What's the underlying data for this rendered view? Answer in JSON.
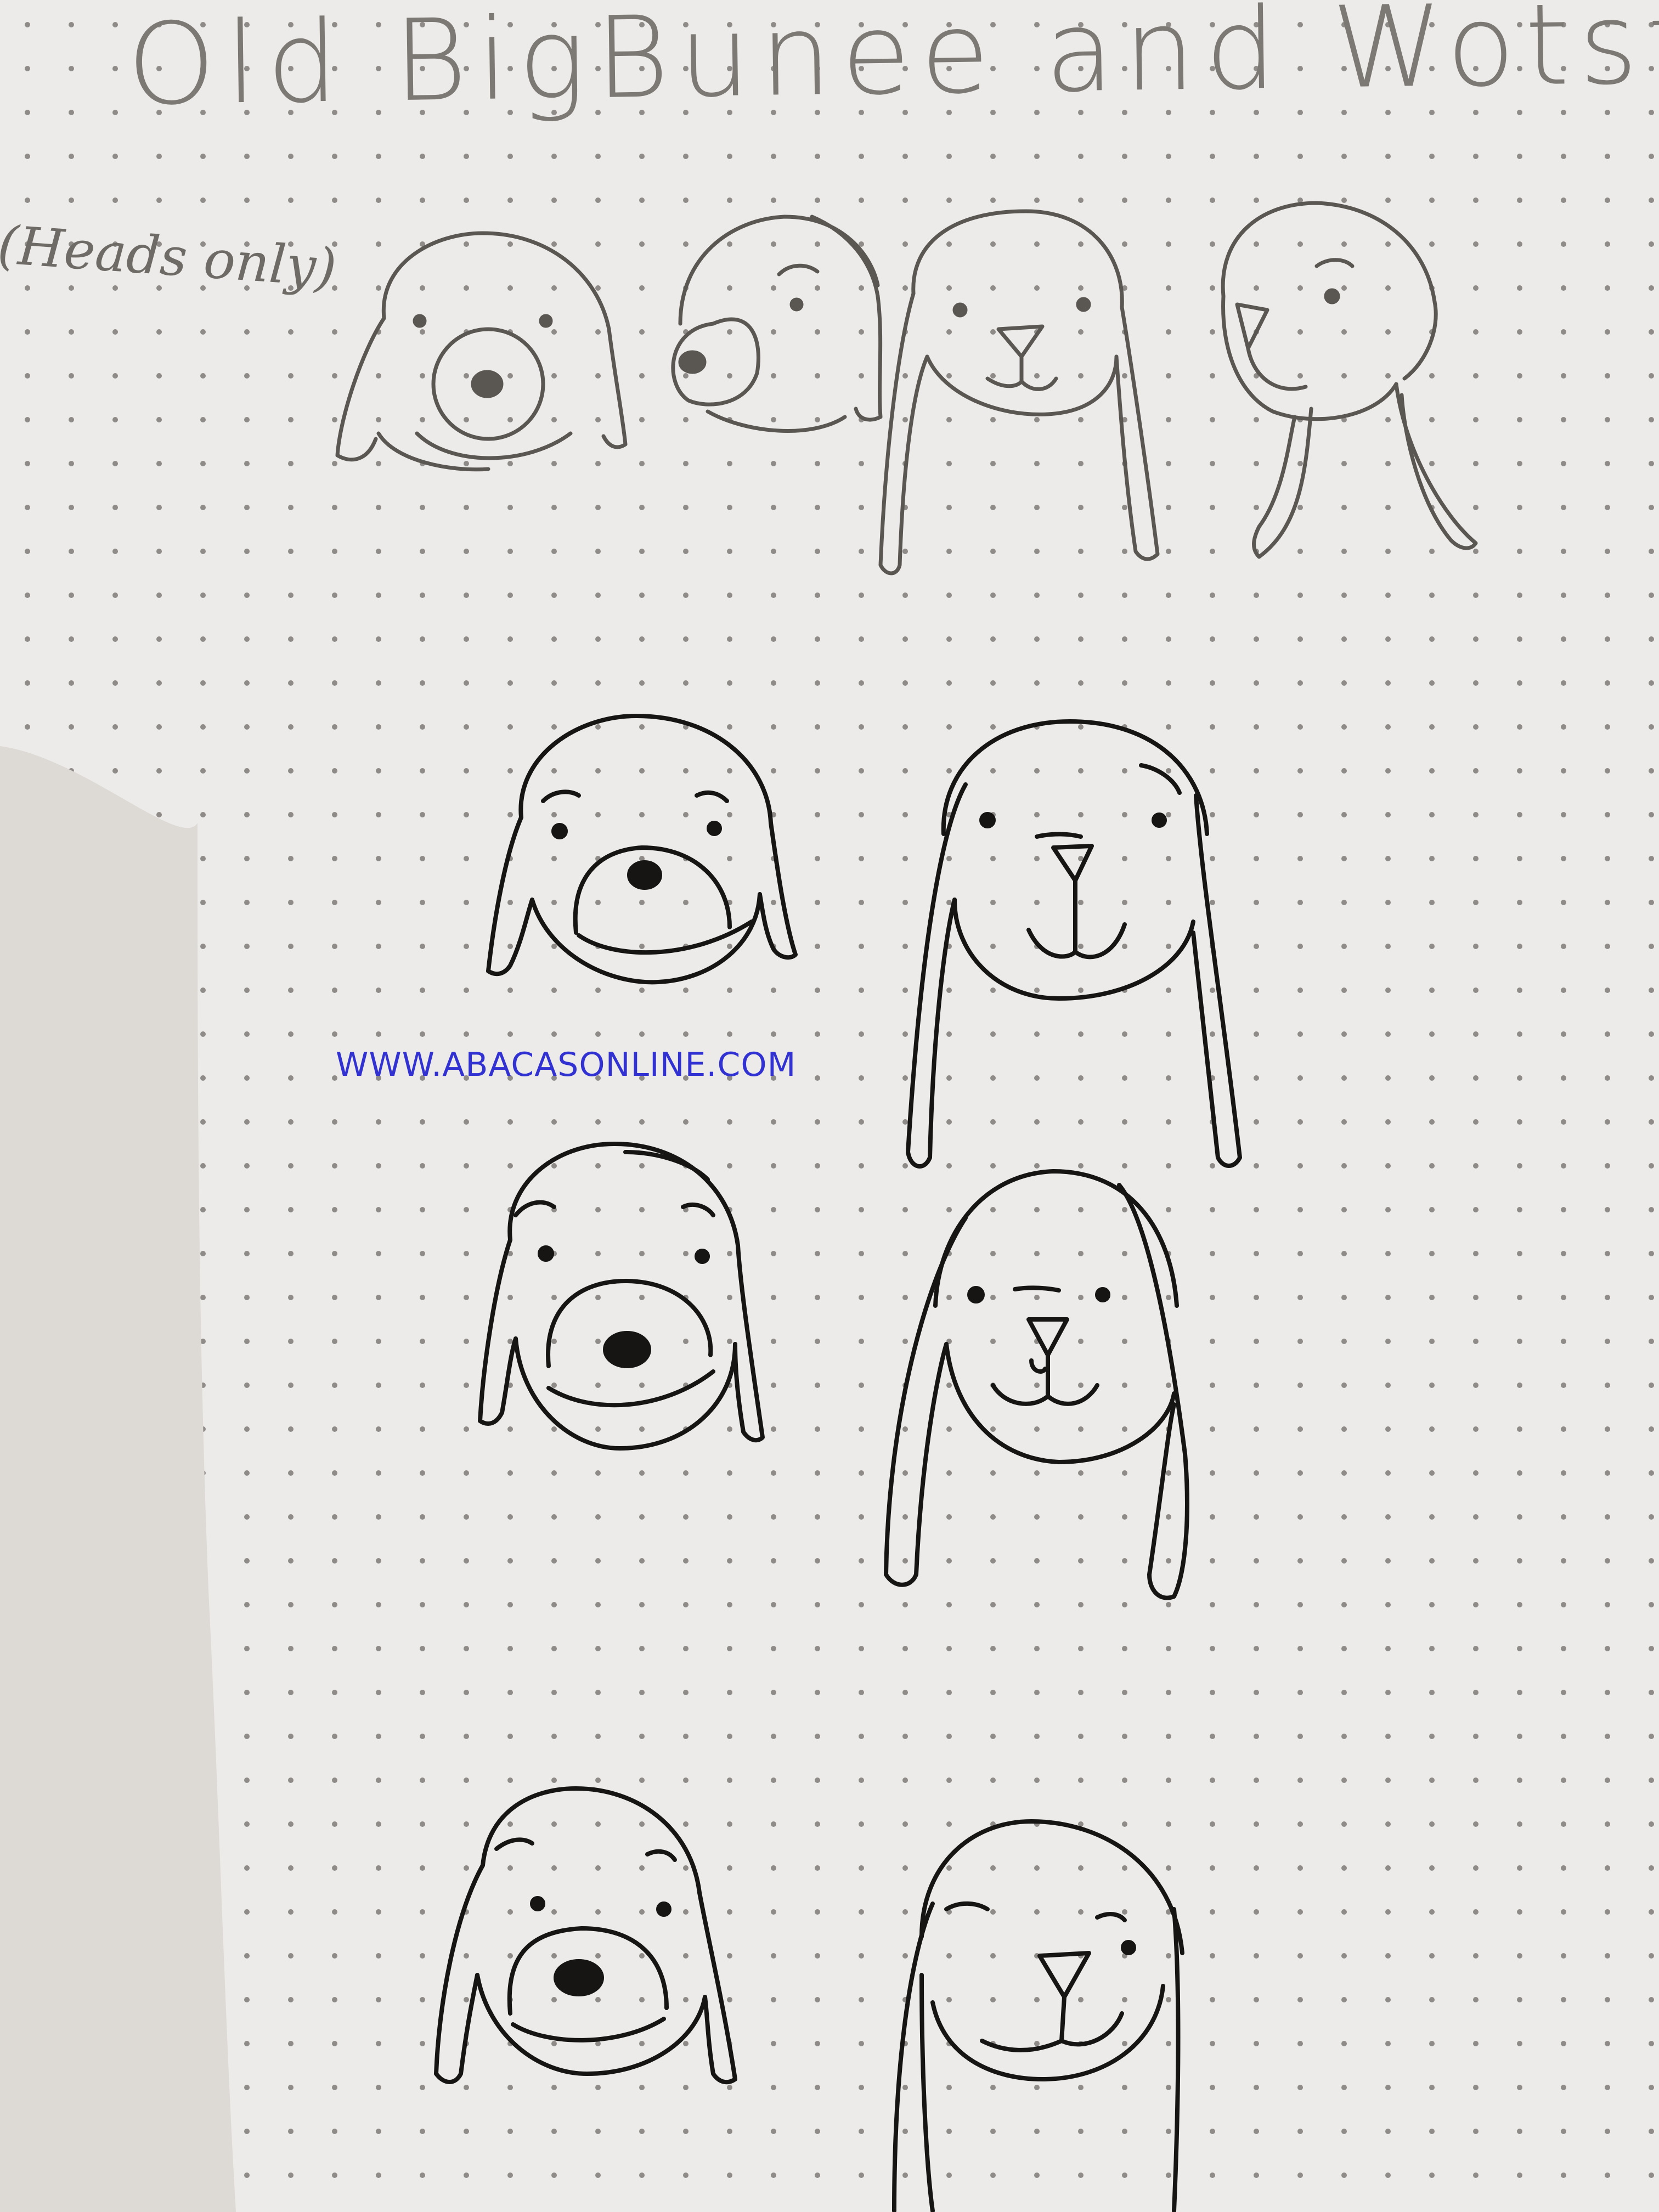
{
  "title": "Old BigBunee and Wotster",
  "subtitle": "(Heads only)",
  "watermark": "WWW.ABACASONLINE.COM",
  "colors": {
    "paper": "#ecebe9",
    "shadow": "#ddd9d4",
    "dot": "#8f8b88",
    "pencil": "#5a5652",
    "ink": "#161514",
    "watermark": "#3232d2"
  },
  "sketches": [
    {
      "row": "pencil-row",
      "characters": [
        "dog",
        "dog",
        "bunny",
        "bunny"
      ]
    },
    {
      "row": "ink-row-1",
      "characters": [
        "dog",
        "bunny"
      ]
    },
    {
      "row": "ink-row-2",
      "characters": [
        "dog",
        "bunny"
      ]
    },
    {
      "row": "ink-row-3",
      "characters": [
        "dog",
        "bunny"
      ]
    }
  ]
}
